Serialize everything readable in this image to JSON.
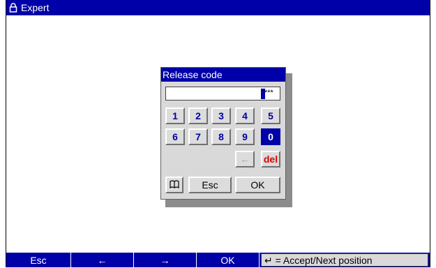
{
  "window": {
    "title": "Expert",
    "icon": "lock-icon"
  },
  "dialog": {
    "title": "Release code",
    "code_value": "",
    "code_mask": "***",
    "digits_row1": [
      "1",
      "2",
      "3",
      "4",
      "5"
    ],
    "digits_row2": [
      "6",
      "7",
      "8",
      "9",
      "0"
    ],
    "selected_key": "0",
    "backspace_label": "←",
    "delete_label": "del",
    "book_icon": "book-icon",
    "esc_label": "Esc",
    "ok_label": "OK"
  },
  "softkeys": {
    "esc": "Esc",
    "left": "←",
    "right": "→",
    "ok": "OK",
    "hint": "↵ = Accept/Next position"
  },
  "colors": {
    "accent": "#0000a8",
    "delete": "#e00000",
    "dialog_bg": "#d9d9d9"
  }
}
